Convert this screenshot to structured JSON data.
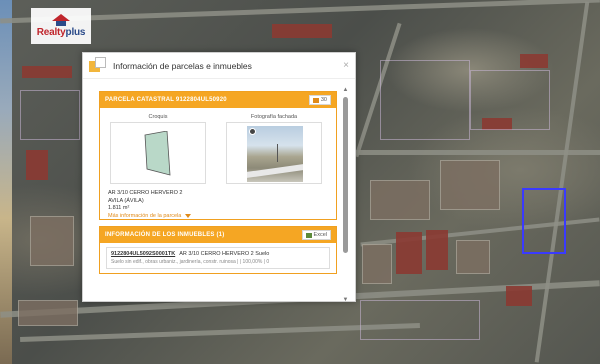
{
  "logo": {
    "brand_part1": "Realty",
    "brand_part2": "plus"
  },
  "dialog": {
    "title": "Información de parcelas e inmuebles",
    "close_label": "×"
  },
  "parcela": {
    "header": "PARCELA CATASTRAL 9122804UL50920",
    "photo_button": "30",
    "croquis_label": "Croquis",
    "fachada_label": "Fotografía fachada",
    "address_line1": "AR 3/10 CERRO HERVERO 2",
    "address_line2": "AVILA (ÁVILA)",
    "area": "1.811 m²",
    "more_link": "Más información de la parcela"
  },
  "inmuebles": {
    "header": "INFORMACIÓN DE LOS INMUEBLES (1)",
    "excel_button": "Excel",
    "rows": [
      {
        "ref": "9122804UL5092S0001TK",
        "address": "AR 3/10 CERRO HERVERO 2 Suelo",
        "details": "Suelo sin edif., obras urbaniz., jardinería, constr. ruinosa | | 100,00% | 0"
      }
    ]
  },
  "colors": {
    "accent": "#f5a623",
    "link": "#e08b1a",
    "brand_red": "#c0262d",
    "brand_blue": "#2b4b8a"
  },
  "icons": [
    "layers-icon",
    "close-icon",
    "camera-icon",
    "excel-icon",
    "chevron-down-icon",
    "scroll-up-icon",
    "scroll-down-icon"
  ]
}
